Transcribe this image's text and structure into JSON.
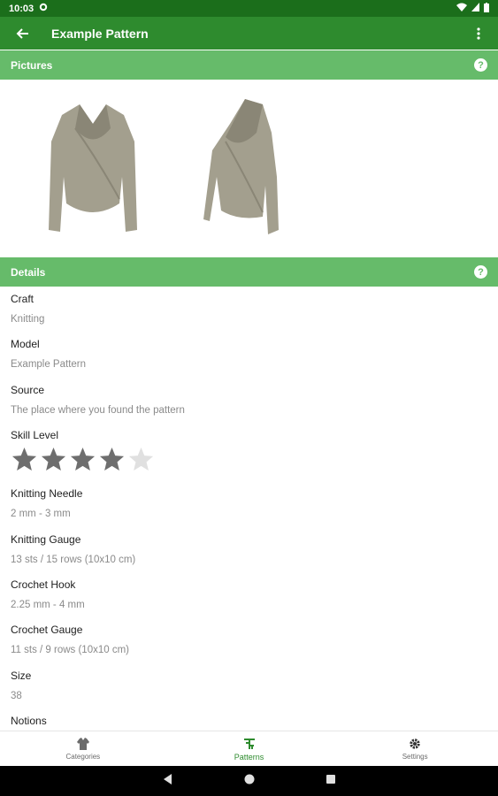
{
  "status_bar": {
    "time": "10:03"
  },
  "app_bar": {
    "title": "Example Pattern"
  },
  "pictures_section": {
    "title": "Pictures",
    "help": "?"
  },
  "details_section": {
    "title": "Details",
    "help": "?"
  },
  "details": [
    {
      "label": "Craft",
      "value": "Knitting"
    },
    {
      "label": "Model",
      "value": "Example Pattern"
    },
    {
      "label": "Source",
      "value": "The place where you found the pattern"
    },
    {
      "label": "Skill Level",
      "rating": 4,
      "max": 5
    },
    {
      "label": "Knitting Needle",
      "value": "2 mm - 3 mm"
    },
    {
      "label": "Knitting Gauge",
      "value": "13 sts / 15 rows (10x10 cm)"
    },
    {
      "label": "Crochet Hook",
      "value": "2.25 mm - 4 mm"
    },
    {
      "label": "Crochet Gauge",
      "value": "11 sts / 9 rows (10x10 cm)"
    },
    {
      "label": "Size",
      "value": "38"
    },
    {
      "label": "Notions",
      "value": ""
    }
  ],
  "bottom_nav": [
    {
      "label": "Categories",
      "icon": "sweater-icon",
      "active": false
    },
    {
      "label": "Patterns",
      "icon": "pattern-icon",
      "active": true
    },
    {
      "label": "Settings",
      "icon": "gear-icon",
      "active": false
    }
  ],
  "colors": {
    "primary_dark": "#1b6e1b",
    "primary": "#2e8b2e",
    "section": "#66bb6a",
    "star": "#6e6e6e",
    "star_empty": "#e0e0e0"
  }
}
